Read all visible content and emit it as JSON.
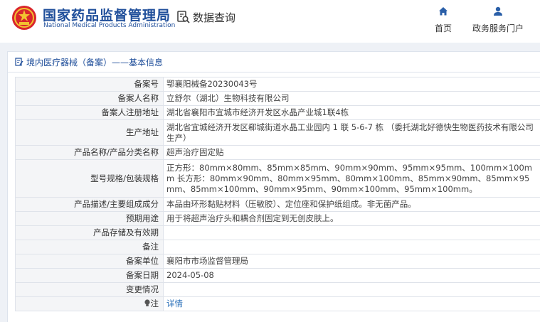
{
  "header": {
    "brand_cn": "国家药品监督管理局",
    "brand_en": "National Medical Products Administration",
    "data_query": "数据查询",
    "nav": [
      {
        "label": "首页",
        "icon": "home-icon"
      },
      {
        "label": "政务服务门户",
        "icon": "user-icon"
      }
    ]
  },
  "breadcrumb": {
    "text": "境内医疗器械（备案）——基本信息"
  },
  "record": {
    "rows": [
      {
        "key": "备案号",
        "value": "鄂襄阳械备20230043号"
      },
      {
        "key": "备案人名称",
        "value": "立舒尔（湖北）生物科技有限公司"
      },
      {
        "key": "备案人注册地址",
        "value": "湖北省襄阳市宜城市经济开发区水晶产业城1联4栋"
      },
      {
        "key": "生产地址",
        "value": "湖北省宜城经济开发区郗城街道水晶工业园内 1 联 5-6-7 栋 （委托湖北好德快生物医药技术有限公司生产）"
      },
      {
        "key": "产品名称/产品分类名称",
        "value": "超声治疗固定贴"
      },
      {
        "key": "型号规格/包装规格",
        "value": "正方形：80mm×80mm、85mm×85mm、90mm×90mm、95mm×95mm、100mm×100mm 长方形：80mm×90mm、80mm×95mm、80mm×100mm、85mm×90mm、85mm×95mm、85mm×100mm、90mm×95mm、90mm×100mm、95mm×100mm。"
      },
      {
        "key": "产品描述/主要组成成分",
        "value": "本品由环形黏贴材料（压敏胶）、定位座和保护纸组成。非无菌产品。"
      },
      {
        "key": "预期用途",
        "value": "用于将超声治疗头和耦合剂固定到无创皮肤上。"
      },
      {
        "key": "产品存储及有效期",
        "value": ""
      },
      {
        "key": "备注",
        "value": ""
      },
      {
        "key": "备案单位",
        "value": "襄阳市市场监督管理局"
      },
      {
        "key": "备案日期",
        "value": "2024-05-08"
      },
      {
        "key": "变更情况",
        "value": ""
      }
    ],
    "note_label": "注",
    "note_link": "详情"
  },
  "colors": {
    "brand_blue": "#1f4e9a",
    "link_blue": "#2a6fb9",
    "emblem_red": "#d9262c",
    "emblem_gold": "#f2c230"
  }
}
